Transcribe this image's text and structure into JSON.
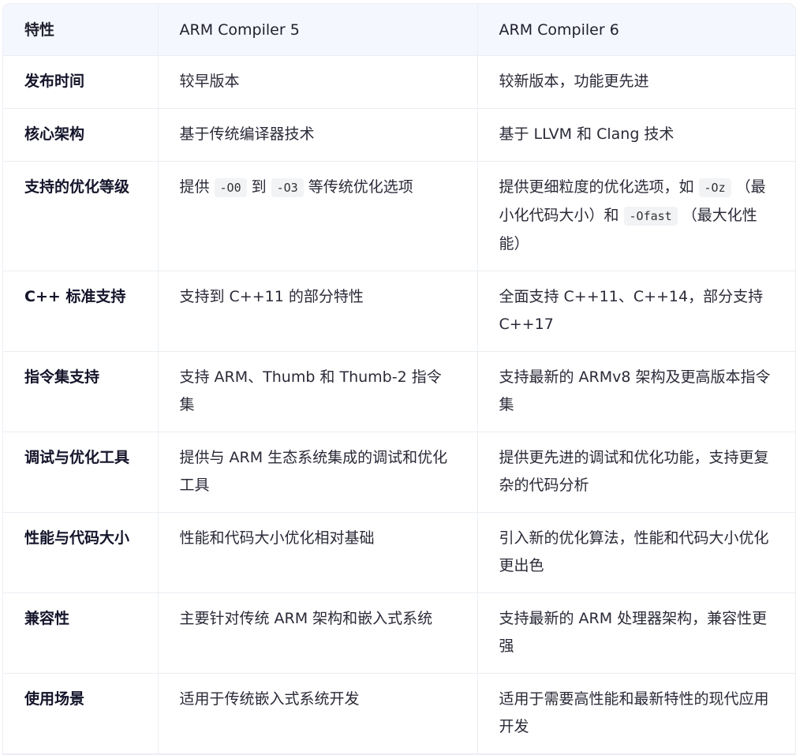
{
  "header": {
    "col1": "特性",
    "col2": "ARM Compiler 5",
    "col3": "ARM Compiler 6"
  },
  "rows": [
    {
      "feature": "发布时间",
      "ac5": "较早版本",
      "ac6": "较新版本，功能更先进"
    },
    {
      "feature": "核心架构",
      "ac5": "基于传统编译器技术",
      "ac6": "基于 LLVM 和 Clang 技术"
    },
    {
      "feature": "支持的优化等级",
      "ac5_parts": [
        "提供",
        "-O0",
        "到",
        "-O3",
        "等传统优化选项"
      ],
      "ac6_parts": [
        "提供更细粒度的优化选项，如",
        "-Oz",
        "（最小化代码大小）和",
        "-Ofast",
        "（最大化性能）"
      ]
    },
    {
      "feature": "C++ 标准支持",
      "ac5": "支持到 C++11 的部分特性",
      "ac6": "全面支持 C++11、C++14，部分支持 C++17"
    },
    {
      "feature": "指令集支持",
      "ac5": "支持 ARM、Thumb 和 Thumb-2 指令集",
      "ac6": "支持最新的 ARMv8 架构及更高版本指令集"
    },
    {
      "feature": "调试与优化工具",
      "ac5": "提供与 ARM 生态系统集成的调试和优化工具",
      "ac6": "提供更先进的调试和优化功能，支持更复杂的代码分析"
    },
    {
      "feature": "性能与代码大小",
      "ac5": "性能和代码大小优化相对基础",
      "ac6": "引入新的优化算法，性能和代码大小优化更出色"
    },
    {
      "feature": "兼容性",
      "ac5": "主要针对传统 ARM 架构和嵌入式系统",
      "ac6": "支持最新的 ARM 处理器架构，兼容性更强"
    },
    {
      "feature": "使用场景",
      "ac5": "适用于传统嵌入式系统开发",
      "ac6": "适用于需要高性能和最新特性的现代应用开发"
    }
  ]
}
